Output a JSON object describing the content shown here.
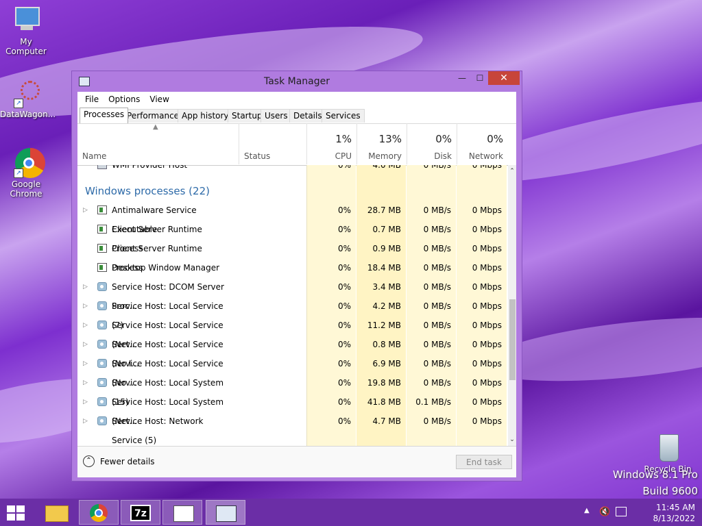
{
  "desktop": {
    "icons": [
      {
        "label": "My Computer"
      },
      {
        "label": "DataWagon..."
      },
      {
        "label": "Google Chrome"
      },
      {
        "label": "Recycle Bin"
      }
    ],
    "watermark_line1": "Windows 8.1 Pro",
    "watermark_line2": "Build 9600"
  },
  "window": {
    "title": "Task Manager",
    "minimize": "—",
    "maximize": "☐",
    "close": "✕",
    "menu": [
      "File",
      "Options",
      "View"
    ],
    "tabs": [
      "Processes",
      "Performance",
      "App history",
      "Startup",
      "Users",
      "Details",
      "Services"
    ],
    "active_tab": "Processes",
    "columns": {
      "name": "Name",
      "status": "Status",
      "cpu": {
        "pct": "1%",
        "label": "CPU"
      },
      "memory": {
        "pct": "13%",
        "label": "Memory"
      },
      "disk": {
        "pct": "0%",
        "label": "Disk"
      },
      "network": {
        "pct": "0%",
        "label": "Network"
      }
    },
    "top_rows": [
      {
        "name": "WMI Provider Host",
        "cpu": "0%",
        "memory": "4.0 MB",
        "disk": "0 MB/s",
        "network": "0 Mbps",
        "icon": "wmi-icon",
        "expandable": false
      }
    ],
    "group_title": "Windows processes (22)",
    "rows": [
      {
        "name": "Antimalware Service Executable",
        "cpu": "0%",
        "memory": "28.7 MB",
        "disk": "0 MB/s",
        "network": "0 Mbps",
        "icon": "window-icon",
        "expandable": true
      },
      {
        "name": "Client Server Runtime Process",
        "cpu": "0%",
        "memory": "0.7 MB",
        "disk": "0 MB/s",
        "network": "0 Mbps",
        "icon": "window-icon",
        "expandable": false
      },
      {
        "name": "Client Server Runtime Process",
        "cpu": "0%",
        "memory": "0.9 MB",
        "disk": "0 MB/s",
        "network": "0 Mbps",
        "icon": "window-icon",
        "expandable": false
      },
      {
        "name": "Desktop Window Manager",
        "cpu": "0%",
        "memory": "18.4 MB",
        "disk": "0 MB/s",
        "network": "0 Mbps",
        "icon": "window-icon",
        "expandable": false
      },
      {
        "name": "Service Host: DCOM Server Proc...",
        "cpu": "0%",
        "memory": "3.4 MB",
        "disk": "0 MB/s",
        "network": "0 Mbps",
        "icon": "gear-icon",
        "expandable": true
      },
      {
        "name": "Service Host: Local Service (7)",
        "cpu": "0%",
        "memory": "4.2 MB",
        "disk": "0 MB/s",
        "network": "0 Mbps",
        "icon": "gear-icon",
        "expandable": true
      },
      {
        "name": "Service Host: Local Service (Net...",
        "cpu": "0%",
        "memory": "11.2 MB",
        "disk": "0 MB/s",
        "network": "0 Mbps",
        "icon": "gear-icon",
        "expandable": true
      },
      {
        "name": "Service Host: Local Service (No I...",
        "cpu": "0%",
        "memory": "0.8 MB",
        "disk": "0 MB/s",
        "network": "0 Mbps",
        "icon": "gear-icon",
        "expandable": true
      },
      {
        "name": "Service Host: Local Service (No ...",
        "cpu": "0%",
        "memory": "6.9 MB",
        "disk": "0 MB/s",
        "network": "0 Mbps",
        "icon": "gear-icon",
        "expandable": true
      },
      {
        "name": "Service Host: Local System (15)",
        "cpu": "0%",
        "memory": "19.8 MB",
        "disk": "0 MB/s",
        "network": "0 Mbps",
        "icon": "gear-icon",
        "expandable": true
      },
      {
        "name": "Service Host: Local System (Net...",
        "cpu": "0%",
        "memory": "41.8 MB",
        "disk": "0.1 MB/s",
        "network": "0 Mbps",
        "icon": "gear-icon",
        "expandable": true
      },
      {
        "name": "Service Host: Network Service (5)",
        "cpu": "0%",
        "memory": "4.7 MB",
        "disk": "0 MB/s",
        "network": "0 Mbps",
        "icon": "gear-icon",
        "expandable": true
      }
    ],
    "fewer_details": "Fewer details",
    "end_task": "End task"
  },
  "taskbar": {
    "apps": [
      "chrome-icon",
      "7zip-icon",
      "explorer-window-icon",
      "task-manager-icon"
    ],
    "seven_zip_label": "7z",
    "clock_time": "11:45 AM",
    "clock_date": "8/13/2022"
  },
  "colors": {
    "cpu_column_bg": "#fff8d6",
    "taskbar": "#6b2ea6",
    "close_button": "#c7453a",
    "group_title": "#2d6aa8"
  }
}
